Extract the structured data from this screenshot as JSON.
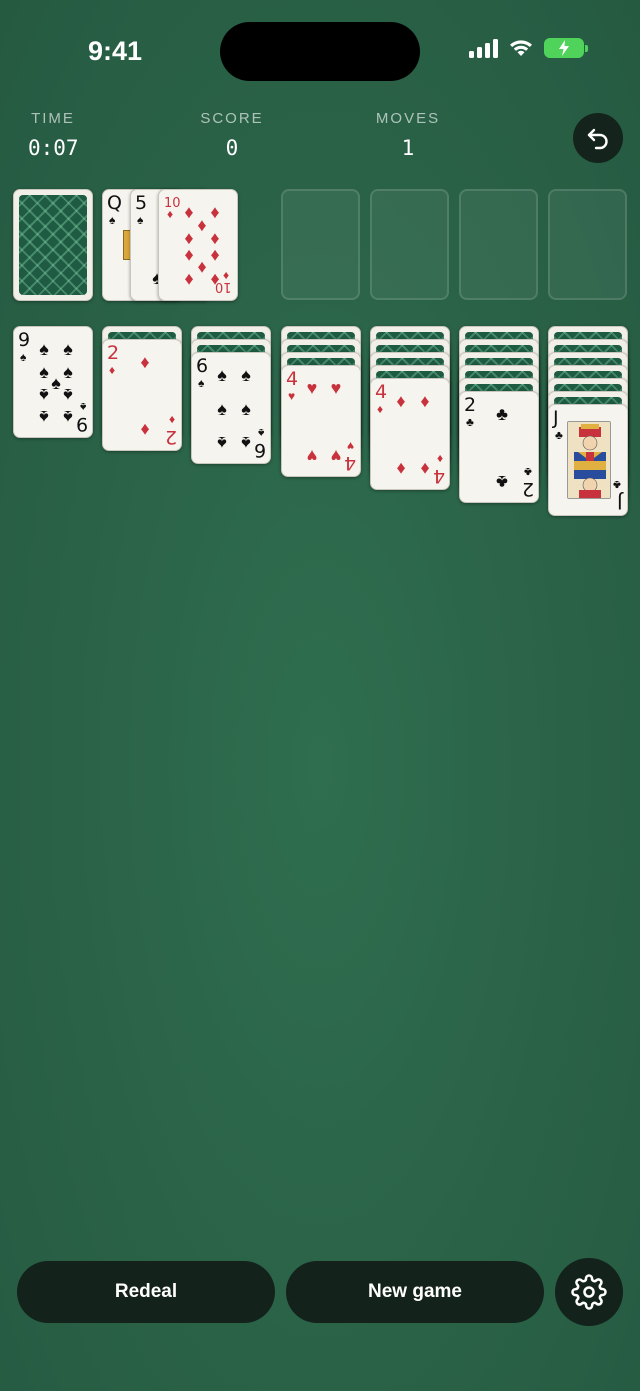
{
  "status_bar": {
    "time": "9:41"
  },
  "stats": {
    "time_label": "TIME",
    "time_value": "0:07",
    "score_label": "SCORE",
    "score_value": "0",
    "moves_label": "MOVES",
    "moves_value": "1"
  },
  "icons": {
    "undo": "undo-arrow-icon",
    "settings": "gear-icon"
  },
  "waste": [
    {
      "rank": "Q",
      "suit": "♠"
    },
    {
      "rank": "5",
      "suit": "♠"
    },
    {
      "rank": "10",
      "suit": "♦"
    }
  ],
  "tableau": [
    {
      "hidden": 0,
      "rank": "9",
      "suit": "♠"
    },
    {
      "hidden": 1,
      "rank": "2",
      "suit": "♦"
    },
    {
      "hidden": 2,
      "rank": "6",
      "suit": "♠"
    },
    {
      "hidden": 3,
      "rank": "4",
      "suit": "♥"
    },
    {
      "hidden": 4,
      "rank": "4",
      "suit": "♦"
    },
    {
      "hidden": 5,
      "rank": "2",
      "suit": "♣"
    },
    {
      "hidden": 6,
      "rank": "J",
      "suit": "♣"
    }
  ],
  "buttons": {
    "redeal": "Redeal",
    "new_game": "New game"
  },
  "colors": {
    "felt": "#2b6449",
    "button_bg": "#13221b",
    "red_suit": "#c8323c",
    "battery": "#4fd35a"
  }
}
